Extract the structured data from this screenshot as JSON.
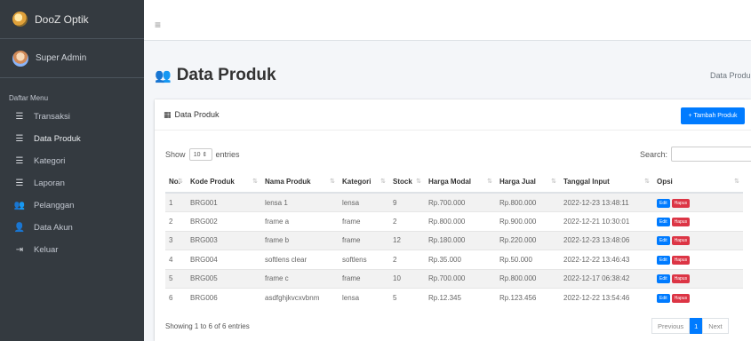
{
  "brand": {
    "name": "DooZ Optik"
  },
  "user": {
    "name": "Super Admin"
  },
  "sidebar": {
    "header": "Daftar Menu",
    "items": [
      {
        "label": "Transaksi",
        "icon": "list-icon"
      },
      {
        "label": "Data Produk",
        "icon": "list-icon"
      },
      {
        "label": "Kategori",
        "icon": "list-icon"
      },
      {
        "label": "Laporan",
        "icon": "list-icon"
      },
      {
        "label": "Pelanggan",
        "icon": "users-icon"
      },
      {
        "label": "Data Akun",
        "icon": "user-accounts-icon"
      },
      {
        "label": "Keluar",
        "icon": "sign-out-icon"
      }
    ]
  },
  "page": {
    "title": "Data Produk",
    "breadcrumb": "Data Produk"
  },
  "card": {
    "title": "Data Produk",
    "add_button": "+ Tambah Produk",
    "show_label": "Show",
    "entries_value": "10",
    "entries_label": "entries",
    "search_label": "Search:",
    "info": "Showing 1 to 6 of 6 entries",
    "pagination": {
      "previous": "Previous",
      "current": "1",
      "next": "Next"
    }
  },
  "table": {
    "headers": [
      "No.",
      "Kode Produk",
      "Nama Produk",
      "Kategori",
      "Stock",
      "Harga Modal",
      "Harga Jual",
      "Tanggal Input",
      "Opsi"
    ],
    "edit_label": "Edit",
    "delete_label": "Hapus",
    "rows": [
      [
        "1",
        "BRG001",
        "lensa 1",
        "lensa",
        "9",
        "Rp.700.000",
        "Rp.800.000",
        "2022-12-23 13:48:11"
      ],
      [
        "2",
        "BRG002",
        "frame a",
        "frame",
        "2",
        "Rp.800.000",
        "Rp.900.000",
        "2022-12-21 10:30:01"
      ],
      [
        "3",
        "BRG003",
        "frame b",
        "frame",
        "12",
        "Rp.180.000",
        "Rp.220.000",
        "2022-12-23 13:48:06"
      ],
      [
        "4",
        "BRG004",
        "softlens clear",
        "softlens",
        "2",
        "Rp.35.000",
        "Rp.50.000",
        "2022-12-22 13:46:43"
      ],
      [
        "5",
        "BRG005",
        "frame c",
        "frame",
        "10",
        "Rp.700.000",
        "Rp.800.000",
        "2022-12-17 06:38:42"
      ],
      [
        "6",
        "BRG006",
        "asdfghjkvcxvbnm",
        "lensa",
        "5",
        "Rp.12.345",
        "Rp.123.456",
        "2022-12-22 13:54:46"
      ]
    ]
  },
  "colors": {
    "sidebar_bg": "#343a40",
    "primary": "#007bff",
    "danger": "#dc3545"
  }
}
